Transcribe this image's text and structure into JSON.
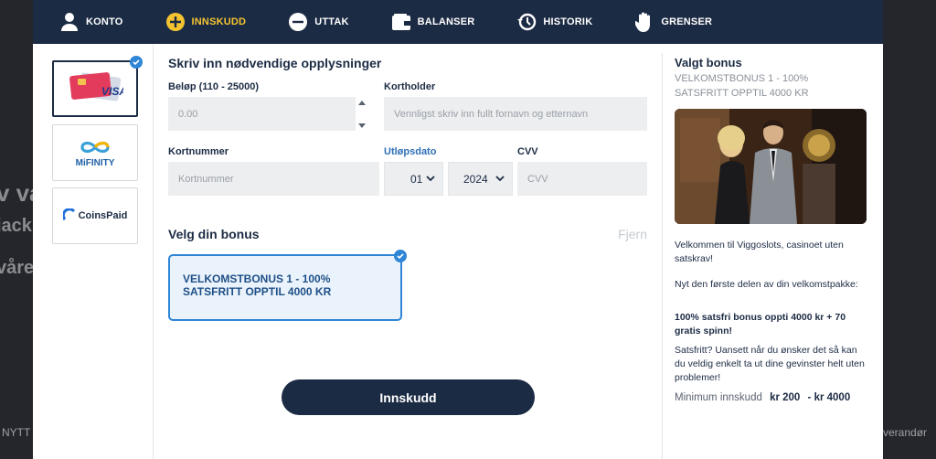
{
  "background": {
    "left_fragments": [
      "v vå",
      "jack",
      "våre"
    ],
    "footer_left": "NYTT",
    "footer_right": "verandør"
  },
  "nav": {
    "items": [
      {
        "label": "KONTO",
        "icon": "user-icon"
      },
      {
        "label": "INNSKUDD",
        "icon": "plus-circle-icon",
        "active": true
      },
      {
        "label": "UTTAK",
        "icon": "minus-circle-icon"
      },
      {
        "label": "BALANSER",
        "icon": "wallet-icon"
      },
      {
        "label": "HISTORIK",
        "icon": "history-icon"
      },
      {
        "label": "GRENSER",
        "icon": "hand-icon"
      }
    ],
    "active_color": "#f4c430",
    "bar_color": "#1c2b44"
  },
  "methods": [
    {
      "name": "VISA",
      "selected": true
    },
    {
      "name": "MIFINITY",
      "selected": false
    },
    {
      "name": "CoinsPaid",
      "selected": false
    }
  ],
  "form": {
    "heading": "Skriv inn nødvendige opplysninger",
    "amount_label": "Beløp (110 - 25000)",
    "amount_placeholder": "0.00",
    "holder_label": "Kortholder",
    "holder_placeholder": "Vennligst skriv inn fullt fornavn og etternavn",
    "card_label": "Kortnummer",
    "card_placeholder": "Kortnummer",
    "expiry_label": "Utløpsdato",
    "expiry_month": "01",
    "expiry_year": "2024",
    "cvv_label": "CVV",
    "cvv_placeholder": "CVV",
    "bonus_heading": "Velg din bonus",
    "remove_label": "Fjern",
    "bonus_option": "VELKOMSTBONUS 1 - 100% SATSFRITT OPPTIL 4000 KR",
    "submit_label": "Innskudd"
  },
  "sidebar": {
    "title": "Valgt bonus",
    "subtitle": "VELKOMSTBONUS 1 - 100% SATSFRITT OPPTIL 4000 KR",
    "p1": "Velkommen til Viggoslots, casinoet uten satskrav!",
    "p2": "Nyt den første delen av din velkomstpakke:",
    "p3": "100% satsfri bonus oppti 4000 kr + 70 gratis spinn!",
    "p4": "Satsfritt? Uansett når du ønsker det så kan du veldig enkelt ta ut dine gevinster helt uten problemer!",
    "min_label": "Minimum innskudd",
    "min_value": "kr 200",
    "max_value": "- kr 4000"
  },
  "colors": {
    "accent_blue": "#2f86d6",
    "navy": "#1c2b44"
  }
}
